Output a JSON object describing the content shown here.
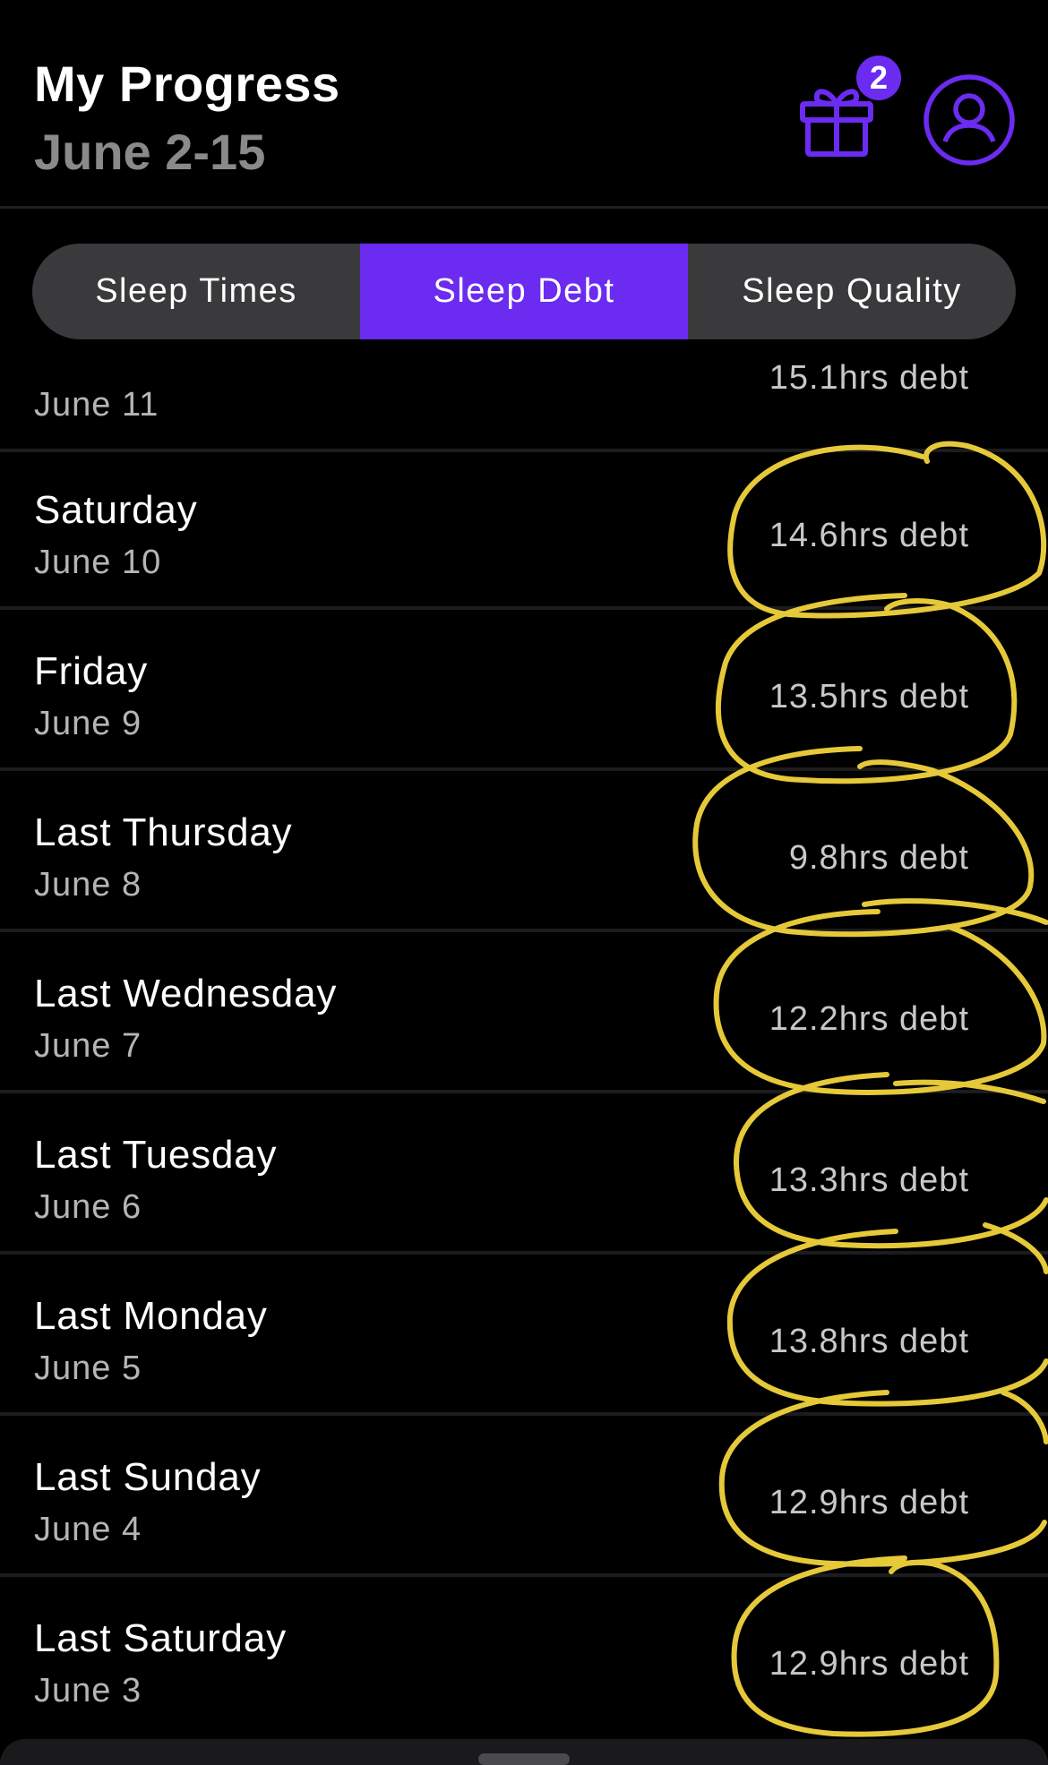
{
  "header": {
    "title": "My Progress",
    "subtitle": "June 2-15",
    "gift_badge_count": "2",
    "gift_icon": "gift-icon",
    "profile_icon": "user-circle-icon",
    "accent_color": "#6b2bf0"
  },
  "tabs": [
    {
      "label": "Sleep Times",
      "active": false
    },
    {
      "label": "Sleep Debt",
      "active": true
    },
    {
      "label": "Sleep Quality",
      "active": false
    }
  ],
  "rows": [
    {
      "day": "",
      "date": "June 11",
      "debt": "15.1hrs debt"
    },
    {
      "day": "Saturday",
      "date": "June 10",
      "debt": "14.6hrs debt"
    },
    {
      "day": "Friday",
      "date": "June 9",
      "debt": "13.5hrs debt"
    },
    {
      "day": "Last Thursday",
      "date": "June 8",
      "debt": "9.8hrs debt"
    },
    {
      "day": "Last Wednesday",
      "date": "June 7",
      "debt": "12.2hrs debt"
    },
    {
      "day": "Last Tuesday",
      "date": "June 6",
      "debt": "13.3hrs debt"
    },
    {
      "day": "Last Monday",
      "date": "June 5",
      "debt": "13.8hrs debt"
    },
    {
      "day": "Last Sunday",
      "date": "June 4",
      "debt": "12.9hrs debt"
    },
    {
      "day": "Last Saturday",
      "date": "June 3",
      "debt": "12.9hrs debt"
    }
  ],
  "annotation_color": "#f2d43d"
}
